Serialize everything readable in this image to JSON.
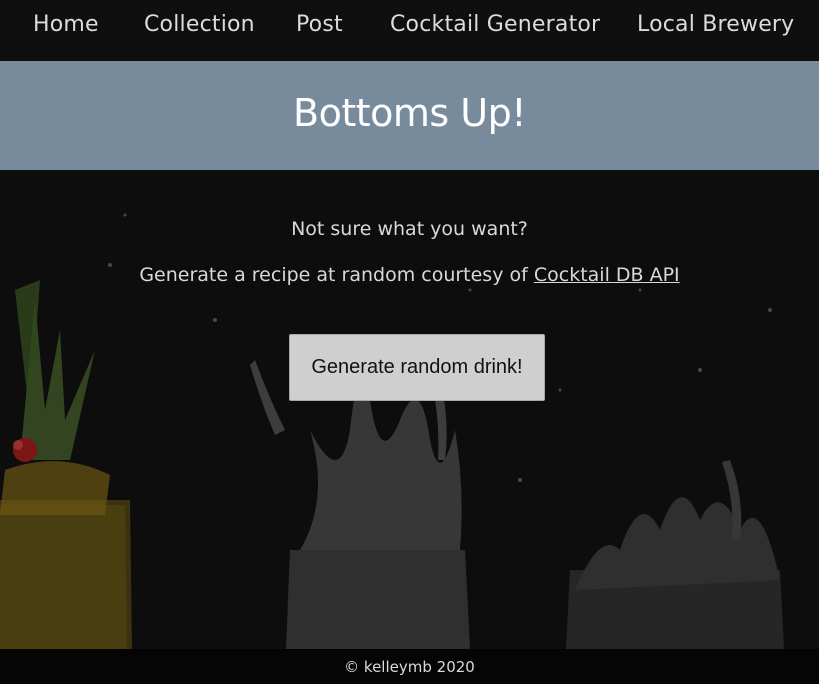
{
  "nav": {
    "items": [
      {
        "label": "Home"
      },
      {
        "label": "Collection"
      },
      {
        "label": "Post"
      },
      {
        "label": "Cocktail Generator"
      },
      {
        "label": "Local Brewery"
      }
    ]
  },
  "banner": {
    "title": "Bottoms Up!"
  },
  "main": {
    "question": "Not sure what you want?",
    "intro_text": "Generate a recipe at random courtesy of ",
    "api_link": "Cocktail DB API",
    "button_label": "Generate random drink!"
  },
  "footer": {
    "text": "© kelleymb 2020"
  },
  "colors": {
    "banner": "#778b9d",
    "navbar": "#0f0f0f",
    "background": "#0d0d0d",
    "button": "#cfcfcf"
  }
}
